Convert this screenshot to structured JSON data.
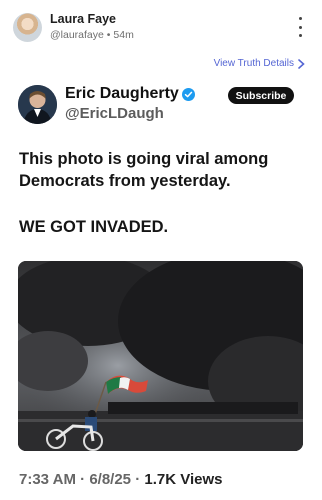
{
  "post": {
    "author_name": "Laura Faye",
    "author_handle": "@laurafaye",
    "separator": "•",
    "time_ago": "54m",
    "view_details": "View Truth Details",
    "more_icon": "more-vertical-icon"
  },
  "embedded_post": {
    "name": "Eric Daugherty",
    "handle": "@EricLDaugh",
    "subscribe_label": "Subscribe",
    "text_line_1": "This photo is going viral among Democrats from yesterday.",
    "text_line_2": "WE GOT INVADED.",
    "time": "7:33 AM",
    "date": "6/8/25",
    "dot": "·",
    "views": "1.7K Views",
    "verified_color": "#1d9bf0"
  },
  "colors": {
    "link": "#5566d4",
    "subscribe_bg": "#111111"
  }
}
